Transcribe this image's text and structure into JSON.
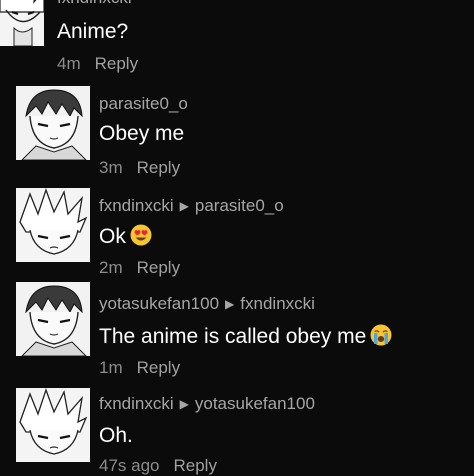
{
  "comments": [
    {
      "username": "fxndinxcki",
      "reply_to": "",
      "text": "Anime?",
      "time": "4m",
      "reply_label": "Reply"
    },
    {
      "username": "parasite0_o",
      "reply_to": "",
      "text": "Obey me",
      "time": "3m",
      "reply_label": "Reply"
    },
    {
      "username": "fxndinxcki",
      "reply_to": "parasite0_o",
      "text": "Ok",
      "time": "2m",
      "reply_label": "Reply",
      "emoji": "heart-eyes-emoji"
    },
    {
      "username": "yotasukefan100",
      "reply_to": "fxndinxcki",
      "text": "The anime is called obey me",
      "time": "1m",
      "reply_label": "Reply",
      "emoji": "crying-emoji"
    },
    {
      "username": "fxndinxcki",
      "reply_to": "yotasukefan100",
      "text": "Oh.",
      "time": "47s ago",
      "reply_label": "Reply"
    }
  ],
  "colors": {
    "background": "#0b0b0b",
    "username": "#a6a6a6",
    "text": "#ffffff",
    "meta": "#8c8c8c"
  }
}
